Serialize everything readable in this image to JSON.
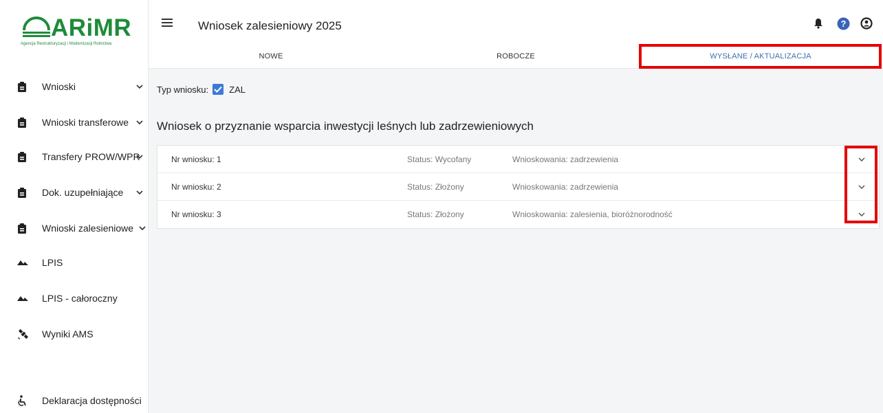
{
  "logo": {
    "text": "ARiMR",
    "subtitle": "Agencja Restrukturyzacji i Modernizacji Rolnictwa"
  },
  "sidebar": {
    "items": [
      {
        "label": "Wnioski",
        "icon": "clipboard-icon",
        "has_chevron": true
      },
      {
        "label": "Wnioski transferowe",
        "icon": "clipboard-icon",
        "has_chevron": true
      },
      {
        "label": "Transfery PROW/WPR",
        "icon": "clipboard-icon",
        "has_chevron": true
      },
      {
        "label": "Dok. uzupełniające",
        "icon": "clipboard-icon",
        "has_chevron": true
      },
      {
        "label": "Wnioski zalesieniowe",
        "icon": "clipboard-icon",
        "has_chevron": true
      },
      {
        "label": "LPIS",
        "icon": "terrain-icon",
        "has_chevron": false
      },
      {
        "label": "LPIS - całoroczny",
        "icon": "terrain-icon",
        "has_chevron": false
      },
      {
        "label": "Wyniki AMS",
        "icon": "satellite-icon",
        "has_chevron": false
      },
      {
        "label": "Deklaracja dostępności",
        "icon": "accessibility-icon",
        "has_chevron": false
      }
    ]
  },
  "header": {
    "title": "Wniosek zalesieniowy 2025",
    "icons": [
      "bell-icon",
      "help-icon",
      "account-icon"
    ]
  },
  "tabs": [
    {
      "label": "NOWE",
      "active": false
    },
    {
      "label": "ROBOCZE",
      "active": false
    },
    {
      "label": "WYSŁANE / AKTUALIZACJA",
      "active": true
    }
  ],
  "filter": {
    "label": "Typ wniosku:",
    "checkbox_label": "ZAL",
    "checked": true
  },
  "section_title": "Wniosek o przyznanie wsparcia inwestycji leśnych lub zadrzewieniowych",
  "applications": [
    {
      "number": "Nr wniosku: 1",
      "status": "Status: Wycofany",
      "type": "Wnioskowania: zadrzewienia"
    },
    {
      "number": "Nr wniosku: 2",
      "status": "Status: Złożony",
      "type": "Wnioskowania: zadrzewienia"
    },
    {
      "number": "Nr wniosku: 3",
      "status": "Status: Złożony",
      "type": "Wnioskowania: zalesienia, bioróżnorodność"
    }
  ],
  "colors": {
    "brand": "#1e8b3a",
    "accent": "#3d6fb0",
    "checkbox": "#3d7ad6",
    "highlight": "#e30000",
    "help": "#3a63b8"
  }
}
